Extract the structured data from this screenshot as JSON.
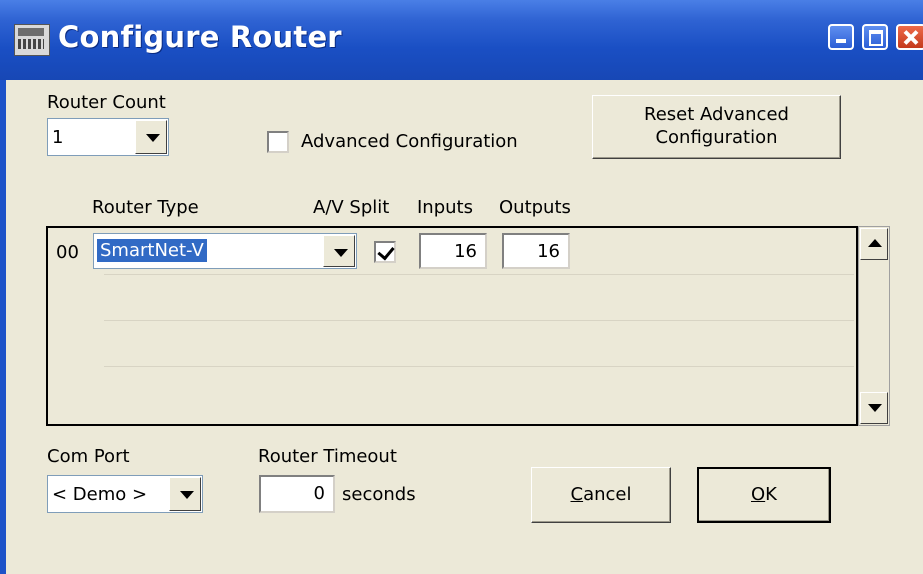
{
  "window": {
    "title": "Configure Router"
  },
  "router_count": {
    "label": "Router Count",
    "value": "1"
  },
  "advanced": {
    "label": "Advanced Configuration",
    "checked": false
  },
  "reset_button": {
    "line1": "Reset Advanced",
    "line2": "Configuration"
  },
  "grid": {
    "headers": {
      "router_type": "Router Type",
      "av_split": "A/V Split",
      "inputs": "Inputs",
      "outputs": "Outputs"
    },
    "rows": [
      {
        "index": "00",
        "router_type": "SmartNet-V",
        "av_split": true,
        "inputs": "16",
        "outputs": "16"
      }
    ]
  },
  "com_port": {
    "label": "Com Port",
    "value": "< Demo >"
  },
  "router_timeout": {
    "label": "Router Timeout",
    "value": "0",
    "unit": "seconds"
  },
  "buttons": {
    "cancel_first": "C",
    "cancel_rest": "ancel",
    "ok_first": "O",
    "ok_rest": "K"
  }
}
